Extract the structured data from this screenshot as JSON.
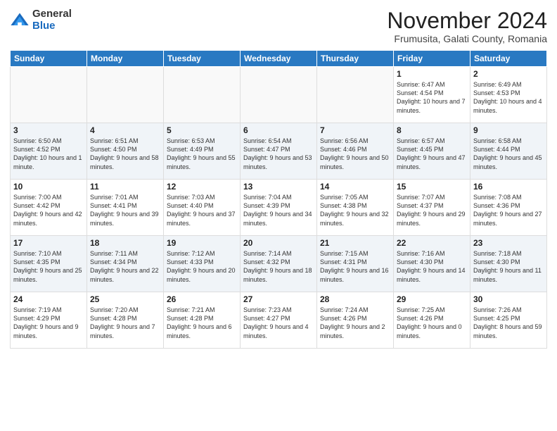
{
  "logo": {
    "general": "General",
    "blue": "Blue"
  },
  "title": "November 2024",
  "location": "Frumusita, Galati County, Romania",
  "headers": [
    "Sunday",
    "Monday",
    "Tuesday",
    "Wednesday",
    "Thursday",
    "Friday",
    "Saturday"
  ],
  "weeks": [
    [
      {
        "day": "",
        "info": ""
      },
      {
        "day": "",
        "info": ""
      },
      {
        "day": "",
        "info": ""
      },
      {
        "day": "",
        "info": ""
      },
      {
        "day": "",
        "info": ""
      },
      {
        "day": "1",
        "info": "Sunrise: 6:47 AM\nSunset: 4:54 PM\nDaylight: 10 hours and 7 minutes."
      },
      {
        "day": "2",
        "info": "Sunrise: 6:49 AM\nSunset: 4:53 PM\nDaylight: 10 hours and 4 minutes."
      }
    ],
    [
      {
        "day": "3",
        "info": "Sunrise: 6:50 AM\nSunset: 4:52 PM\nDaylight: 10 hours and 1 minute."
      },
      {
        "day": "4",
        "info": "Sunrise: 6:51 AM\nSunset: 4:50 PM\nDaylight: 9 hours and 58 minutes."
      },
      {
        "day": "5",
        "info": "Sunrise: 6:53 AM\nSunset: 4:49 PM\nDaylight: 9 hours and 55 minutes."
      },
      {
        "day": "6",
        "info": "Sunrise: 6:54 AM\nSunset: 4:47 PM\nDaylight: 9 hours and 53 minutes."
      },
      {
        "day": "7",
        "info": "Sunrise: 6:56 AM\nSunset: 4:46 PM\nDaylight: 9 hours and 50 minutes."
      },
      {
        "day": "8",
        "info": "Sunrise: 6:57 AM\nSunset: 4:45 PM\nDaylight: 9 hours and 47 minutes."
      },
      {
        "day": "9",
        "info": "Sunrise: 6:58 AM\nSunset: 4:44 PM\nDaylight: 9 hours and 45 minutes."
      }
    ],
    [
      {
        "day": "10",
        "info": "Sunrise: 7:00 AM\nSunset: 4:42 PM\nDaylight: 9 hours and 42 minutes."
      },
      {
        "day": "11",
        "info": "Sunrise: 7:01 AM\nSunset: 4:41 PM\nDaylight: 9 hours and 39 minutes."
      },
      {
        "day": "12",
        "info": "Sunrise: 7:03 AM\nSunset: 4:40 PM\nDaylight: 9 hours and 37 minutes."
      },
      {
        "day": "13",
        "info": "Sunrise: 7:04 AM\nSunset: 4:39 PM\nDaylight: 9 hours and 34 minutes."
      },
      {
        "day": "14",
        "info": "Sunrise: 7:05 AM\nSunset: 4:38 PM\nDaylight: 9 hours and 32 minutes."
      },
      {
        "day": "15",
        "info": "Sunrise: 7:07 AM\nSunset: 4:37 PM\nDaylight: 9 hours and 29 minutes."
      },
      {
        "day": "16",
        "info": "Sunrise: 7:08 AM\nSunset: 4:36 PM\nDaylight: 9 hours and 27 minutes."
      }
    ],
    [
      {
        "day": "17",
        "info": "Sunrise: 7:10 AM\nSunset: 4:35 PM\nDaylight: 9 hours and 25 minutes."
      },
      {
        "day": "18",
        "info": "Sunrise: 7:11 AM\nSunset: 4:34 PM\nDaylight: 9 hours and 22 minutes."
      },
      {
        "day": "19",
        "info": "Sunrise: 7:12 AM\nSunset: 4:33 PM\nDaylight: 9 hours and 20 minutes."
      },
      {
        "day": "20",
        "info": "Sunrise: 7:14 AM\nSunset: 4:32 PM\nDaylight: 9 hours and 18 minutes."
      },
      {
        "day": "21",
        "info": "Sunrise: 7:15 AM\nSunset: 4:31 PM\nDaylight: 9 hours and 16 minutes."
      },
      {
        "day": "22",
        "info": "Sunrise: 7:16 AM\nSunset: 4:30 PM\nDaylight: 9 hours and 14 minutes."
      },
      {
        "day": "23",
        "info": "Sunrise: 7:18 AM\nSunset: 4:30 PM\nDaylight: 9 hours and 11 minutes."
      }
    ],
    [
      {
        "day": "24",
        "info": "Sunrise: 7:19 AM\nSunset: 4:29 PM\nDaylight: 9 hours and 9 minutes."
      },
      {
        "day": "25",
        "info": "Sunrise: 7:20 AM\nSunset: 4:28 PM\nDaylight: 9 hours and 7 minutes."
      },
      {
        "day": "26",
        "info": "Sunrise: 7:21 AM\nSunset: 4:28 PM\nDaylight: 9 hours and 6 minutes."
      },
      {
        "day": "27",
        "info": "Sunrise: 7:23 AM\nSunset: 4:27 PM\nDaylight: 9 hours and 4 minutes."
      },
      {
        "day": "28",
        "info": "Sunrise: 7:24 AM\nSunset: 4:26 PM\nDaylight: 9 hours and 2 minutes."
      },
      {
        "day": "29",
        "info": "Sunrise: 7:25 AM\nSunset: 4:26 PM\nDaylight: 9 hours and 0 minutes."
      },
      {
        "day": "30",
        "info": "Sunrise: 7:26 AM\nSunset: 4:25 PM\nDaylight: 8 hours and 59 minutes."
      }
    ]
  ]
}
